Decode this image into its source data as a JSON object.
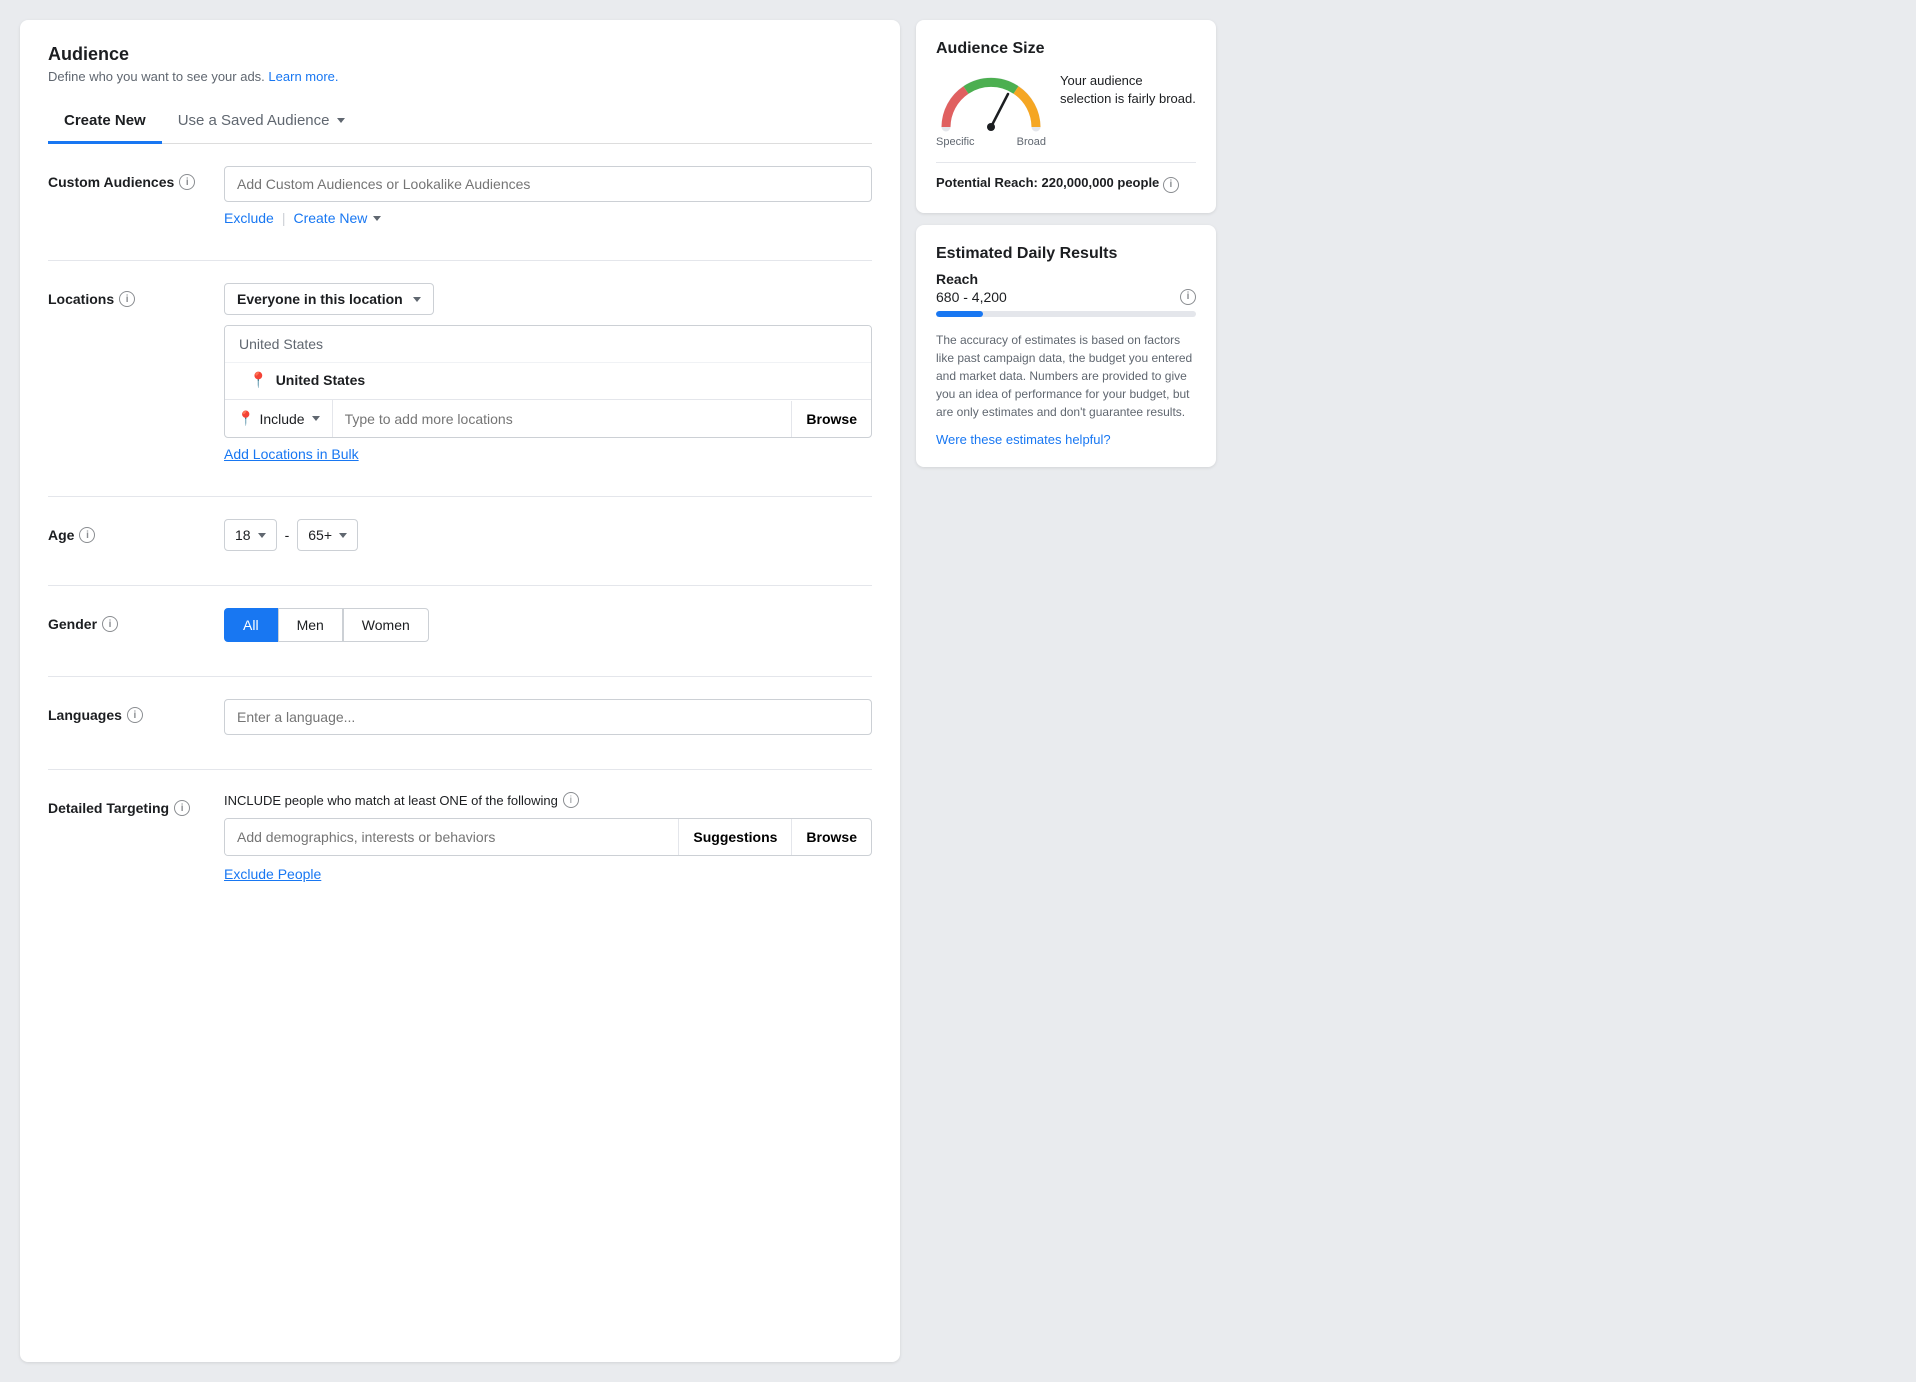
{
  "header": {
    "title": "Audience",
    "subtitle": "Define who you want to see your ads.",
    "learn_more": "Learn more."
  },
  "tabs": [
    {
      "id": "create-new",
      "label": "Create New",
      "active": true
    },
    {
      "id": "saved-audience",
      "label": "Use a Saved Audience",
      "active": false
    }
  ],
  "custom_audiences": {
    "label": "Custom Audiences",
    "placeholder": "Add Custom Audiences or Lookalike Audiences",
    "exclude_label": "Exclude",
    "create_new_label": "Create New"
  },
  "locations": {
    "label": "Locations",
    "dropdown_label": "Everyone in this location",
    "search_header": "United States",
    "selected_location": "United States",
    "include_label": "Include",
    "location_placeholder": "Type to add more locations",
    "browse_label": "Browse",
    "add_bulk_label": "Add Locations in Bulk"
  },
  "age": {
    "label": "Age",
    "min": "18",
    "max": "65+",
    "separator": "-"
  },
  "gender": {
    "label": "Gender",
    "options": [
      "All",
      "Men",
      "Women"
    ],
    "selected": "All"
  },
  "languages": {
    "label": "Languages",
    "placeholder": "Enter a language..."
  },
  "detailed_targeting": {
    "label": "Detailed Targeting",
    "description": "INCLUDE people who match at least ONE of the following",
    "placeholder": "Add demographics, interests or behaviors",
    "suggestions_label": "Suggestions",
    "browse_label": "Browse",
    "exclude_label": "Exclude People"
  },
  "audience_size": {
    "title": "Audience Size",
    "description": "Your audience selection is fairly broad.",
    "gauge_specific": "Specific",
    "gauge_broad": "Broad",
    "potential_reach_label": "Potential Reach:",
    "potential_reach_value": "220,000,000 people"
  },
  "estimated_results": {
    "title": "Estimated Daily Results",
    "reach_label": "Reach",
    "reach_range": "680 - 4,200",
    "note": "The accuracy of estimates is based on factors like past campaign data, the budget you entered and market data. Numbers are provided to give you an idea of performance for your budget, but are only estimates and don't guarantee results.",
    "helpful_label": "Were these estimates helpful?"
  }
}
